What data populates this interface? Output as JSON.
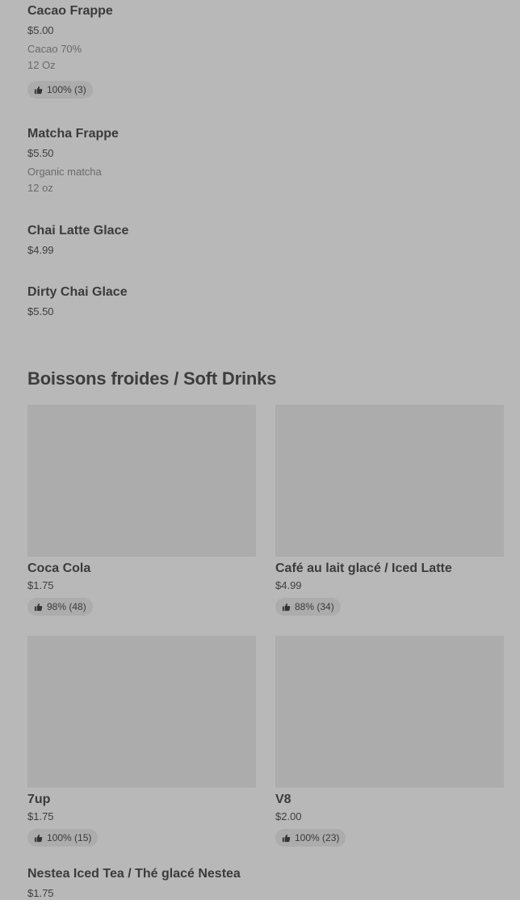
{
  "menu_items": [
    {
      "name": "Cacao Frappe",
      "price": "$5.00",
      "desc": [
        "Cacao 70%",
        "12 Oz"
      ],
      "rating": "100% (3)"
    },
    {
      "name": "Matcha Frappe",
      "price": "$5.50",
      "desc": [
        "Organic matcha",
        "12 oz"
      ]
    },
    {
      "name": "Chai Latte Glace",
      "price": "$4.99"
    },
    {
      "name": "Dirty Chai Glace",
      "price": "$5.50"
    }
  ],
  "section": {
    "title": "Boissons froides / Soft Drinks"
  },
  "cards": [
    {
      "name": "Coca Cola",
      "price": "$1.75",
      "rating": "98% (48)"
    },
    {
      "name": "Café au lait glacé / Iced Latte",
      "price": "$4.99",
      "rating": "88% (34)"
    },
    {
      "name": "7up",
      "price": "$1.75",
      "rating": "100% (15)"
    },
    {
      "name": "V8",
      "price": "$2.00",
      "rating": "100% (23)"
    }
  ],
  "bottom_item": {
    "name": "Nestea Iced Tea / Thé glacé Nestea",
    "price": "$1.75"
  },
  "icons": {
    "rating": "thumbs-up-icon"
  },
  "colors": {
    "background": "#b8b8b8",
    "placeholder": "#acacac",
    "text": "#3a3a3a",
    "muted": "#6a6a6a"
  }
}
